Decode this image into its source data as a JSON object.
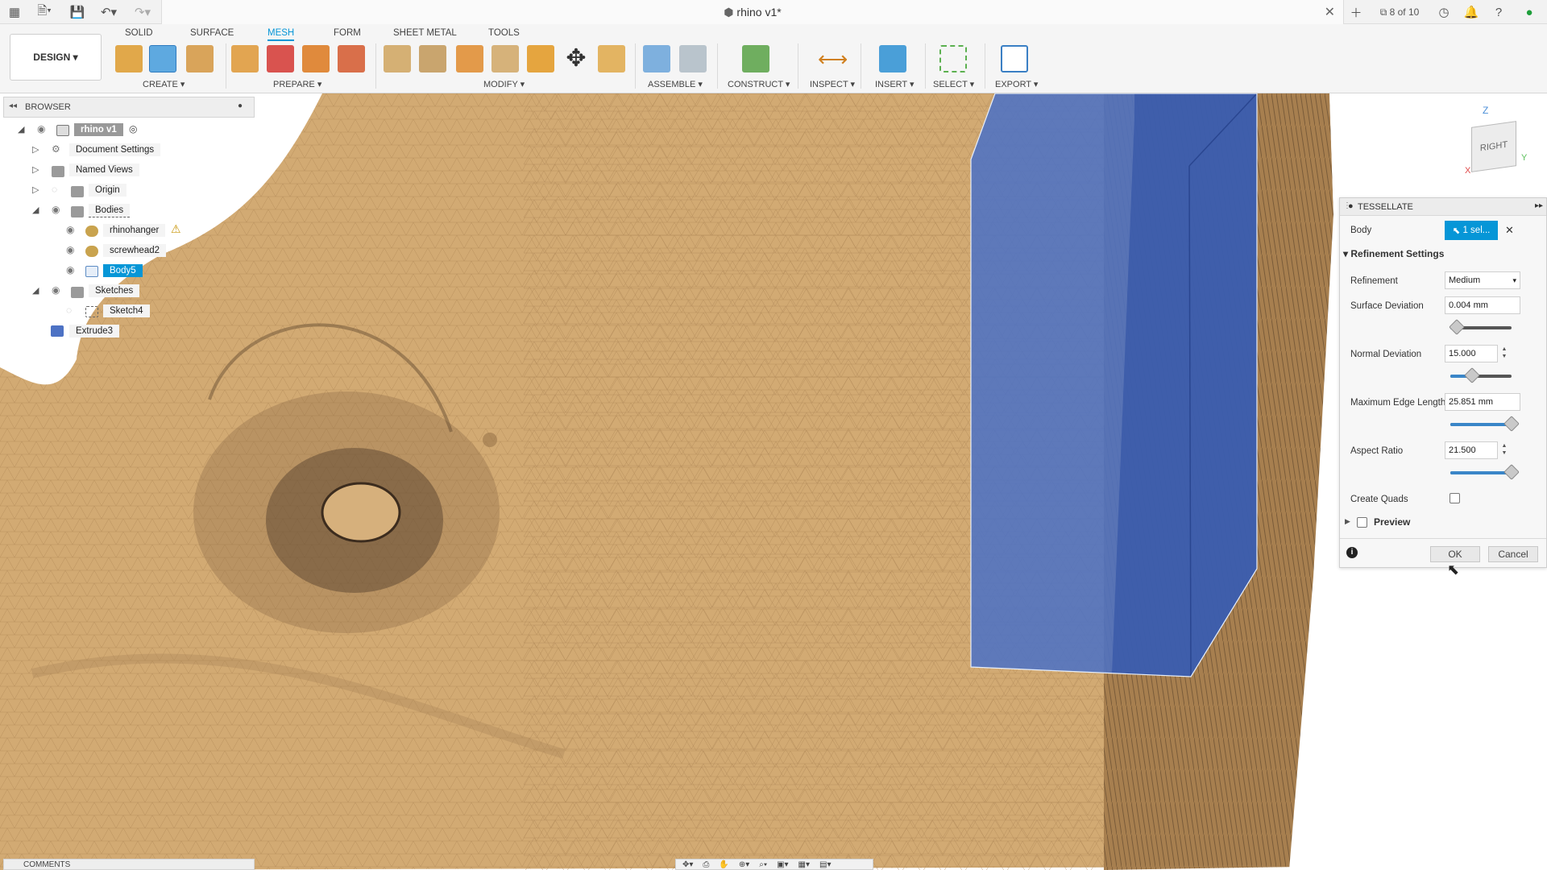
{
  "window": {
    "title": "rhino v1*",
    "job_status": "8 of 10"
  },
  "toolbar": {
    "design_label": "DESIGN",
    "tabs": [
      "SOLID",
      "SURFACE",
      "MESH",
      "FORM",
      "SHEET METAL",
      "TOOLS"
    ],
    "active_tab": "MESH",
    "groups": [
      "CREATE",
      "PREPARE",
      "MODIFY",
      "ASSEMBLE",
      "CONSTRUCT",
      "INSPECT",
      "INSERT",
      "SELECT",
      "EXPORT"
    ]
  },
  "browser": {
    "title": "BROWSER",
    "root": "rhino v1",
    "items": [
      {
        "label": "Document Settings"
      },
      {
        "label": "Named Views"
      },
      {
        "label": "Origin"
      },
      {
        "label": "Bodies"
      },
      {
        "label": "rhinohanger"
      },
      {
        "label": "screwhead2"
      },
      {
        "label": "Body5"
      },
      {
        "label": "Sketches"
      },
      {
        "label": "Sketch4"
      },
      {
        "label": "Extrude3"
      }
    ]
  },
  "comments": {
    "title": "COMMENTS"
  },
  "viewcube": {
    "face": "RIGHT",
    "z": "Z",
    "x": "X",
    "y": "Y"
  },
  "dialog": {
    "title": "TESSELLATE",
    "body_label": "Body",
    "body_value": "1 sel...",
    "section": "Refinement Settings",
    "refinement_label": "Refinement",
    "refinement_value": "Medium",
    "surface_deviation_label": "Surface Deviation",
    "surface_deviation_value": "0.004 mm",
    "surface_deviation_level": 0.1,
    "normal_deviation_label": "Normal Deviation",
    "normal_deviation_value": "15.000",
    "normal_deviation_level": 0.35,
    "max_edge_label": "Maximum Edge Length",
    "max_edge_value": "25.851 mm",
    "max_edge_level": 1.0,
    "aspect_ratio_label": "Aspect Ratio",
    "aspect_ratio_value": "21.500",
    "aspect_ratio_level": 1.0,
    "create_quads_label": "Create Quads",
    "preview_label": "Preview",
    "ok_label": "OK",
    "cancel_label": "Cancel"
  },
  "colors": {
    "accent": "#0696d7",
    "mesh": "#d1a872",
    "body_blue": "#4a73c2"
  }
}
